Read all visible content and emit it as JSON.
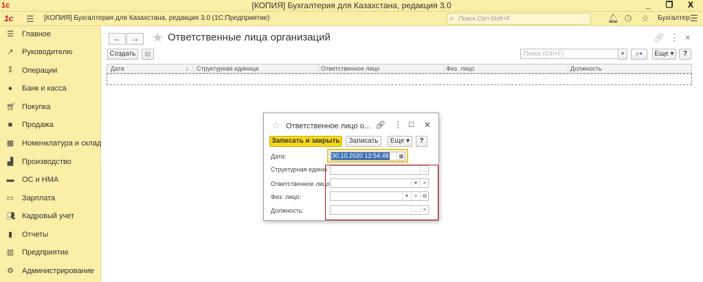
{
  "window": {
    "logo": "1c",
    "title": "[КОПИЯ] Бухгалтерия для Казахстана, редакция 3.0",
    "controls": [
      "_",
      "❐",
      "X"
    ]
  },
  "appbar": {
    "logo": "1с",
    "app_title": "[КОПИЯ] Бухгалтерия для Казахстана, редакция 3.0  (1С:Предприятие)",
    "search_placeholder": "Поиск Ctrl+Shift+F",
    "user": "Бухгалтер"
  },
  "sidebar": {
    "items": [
      {
        "label": "Главное",
        "icon": "menu-icon"
      },
      {
        "label": "Руководителю",
        "icon": "trend-icon"
      },
      {
        "label": "Операции",
        "icon": "operations-icon"
      },
      {
        "label": "Банк и касса",
        "icon": "money-icon"
      },
      {
        "label": "Покупка",
        "icon": "cart-icon"
      },
      {
        "label": "Продажа",
        "icon": "bag-icon"
      },
      {
        "label": "Номенклатура и склад",
        "icon": "grid-icon"
      },
      {
        "label": "Производство",
        "icon": "factory-icon"
      },
      {
        "label": "ОС и НМА",
        "icon": "truck-icon"
      },
      {
        "label": "Зарплата",
        "icon": "payroll-icon"
      },
      {
        "label": "Кадровый учет",
        "icon": "people-icon"
      },
      {
        "label": "Отчеты",
        "icon": "chart-icon"
      },
      {
        "label": "Предприятие",
        "icon": "building-icon"
      },
      {
        "label": "Администрирование",
        "icon": "gear-icon"
      }
    ]
  },
  "main": {
    "title": "Ответственные лица организаций",
    "create_label": "Создать",
    "search_placeholder": "Поиск (Ctrl+F)",
    "more_label": "Еще",
    "help_label": "?",
    "columns": [
      "Дата",
      "Структурная единица",
      "Ответственное лицо",
      "Физ. лицо",
      "Должность"
    ]
  },
  "dialog": {
    "title": "Ответственное лицо о...",
    "save_close_label": "Записать и закрыть",
    "save_label": "Записать",
    "more_label": "Еще",
    "help_label": "?",
    "fields": {
      "date_label": "Дата:",
      "date_value": "30.10.2020 12:54:48",
      "unit_label": "Структурная единица:",
      "person_label": "Ответственное лицо:",
      "individual_label": "Физ. лицо:",
      "position_label": "Должность:"
    }
  },
  "colors": {
    "panel_yellow": "#fbeea6",
    "primary_button": "#f5d91b",
    "logo_red": "#d4131a",
    "highlight_border": "#b01818"
  }
}
